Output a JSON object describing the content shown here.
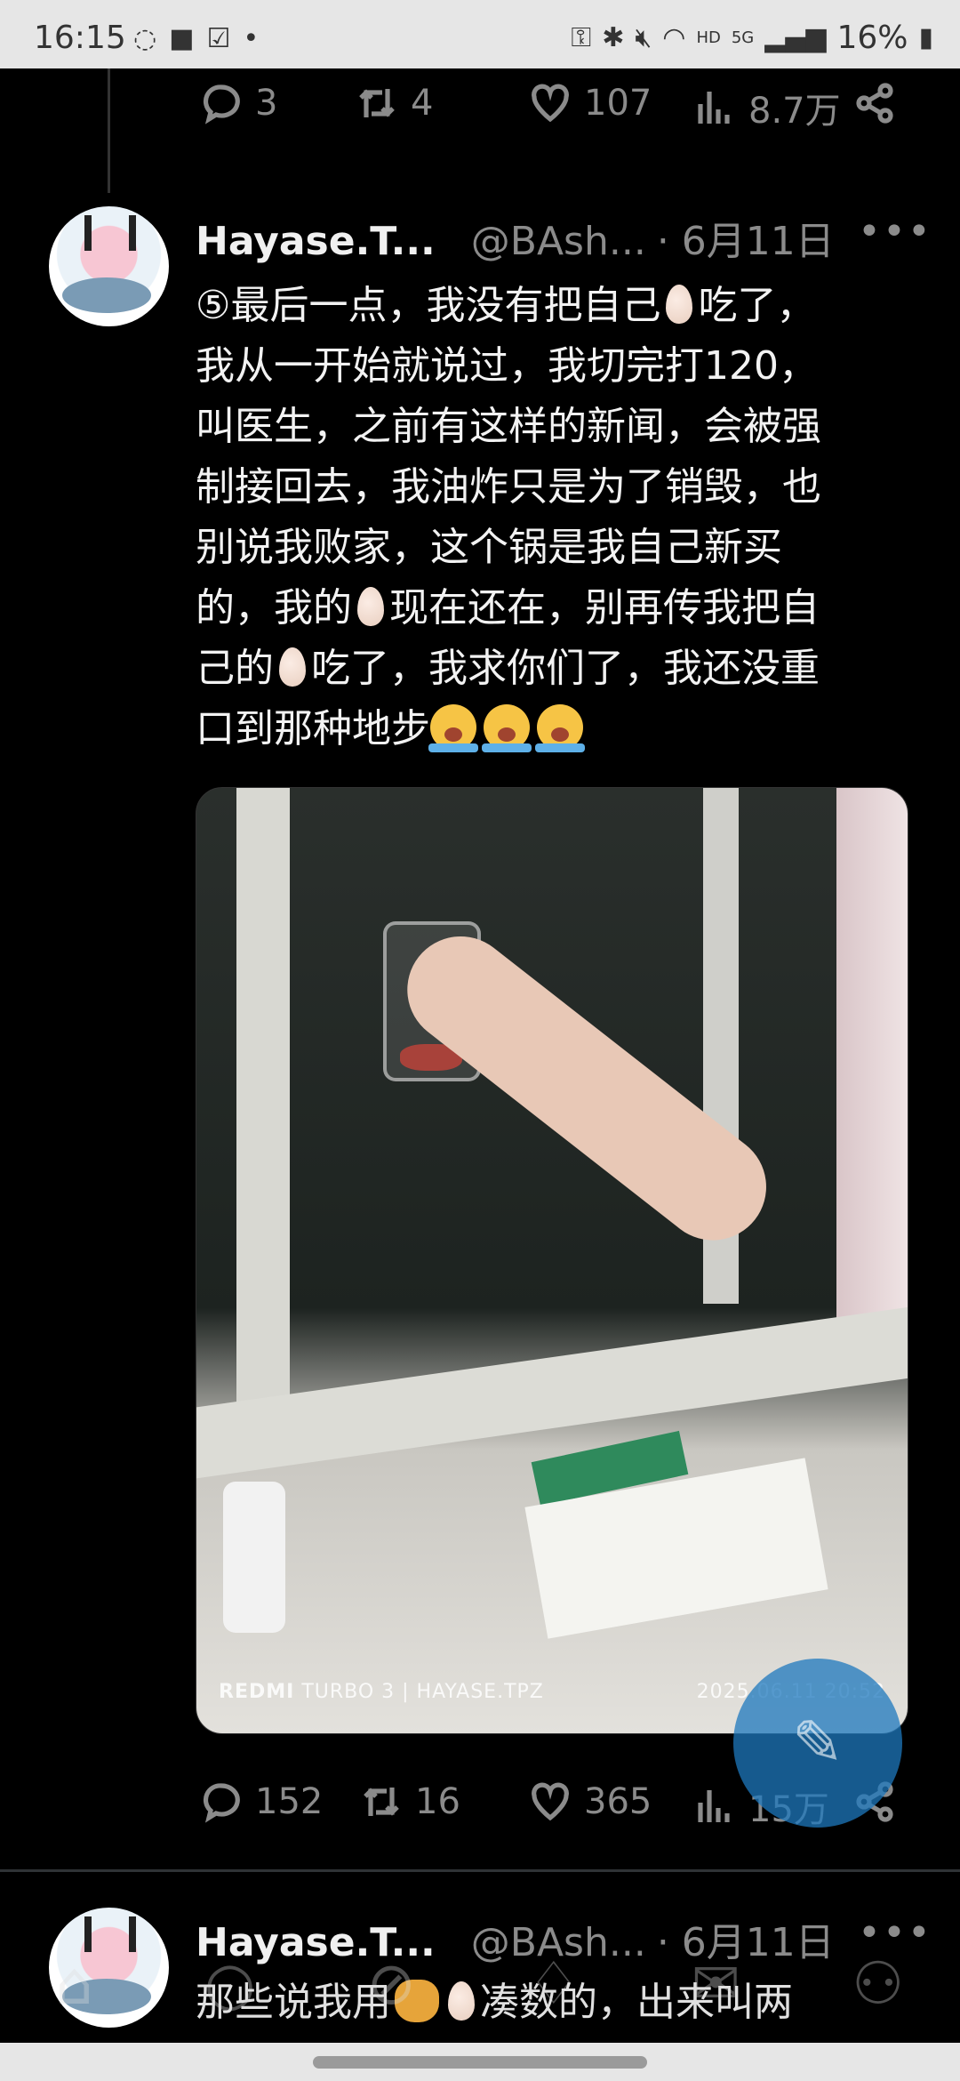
{
  "status_bar": {
    "time": "16:15",
    "network": "5G",
    "hd": "HD",
    "battery": "16%"
  },
  "prev_post": {
    "actions": {
      "replies": "3",
      "reposts": "4",
      "likes": "107",
      "views": "8.7万"
    }
  },
  "post": {
    "author_name": "Hayase.T...",
    "handle": "@BAsh...",
    "date": "· 6月11日",
    "more": "•••",
    "lines": [
      "⑤最后一点，我没有把自己",
      "吃了，",
      "我从一开始就说过，我切完打120，",
      "叫医生，之前有这样的新闻，会被强",
      "制接回去，我油炸只是为了销毁，也",
      "别说我败家，这个锅是我自己新买",
      "的，我的",
      "现在还在，别再传我把自",
      "己的",
      "吃了，我求你们了，我还没重",
      "口到那种地步"
    ],
    "photo": {
      "watermark_brand": "REDMI",
      "watermark_model": "TURBO 3 | HAYASE.TPZ",
      "watermark_date": "2025.06.11 20:52"
    },
    "actions": {
      "replies": "152",
      "reposts": "16",
      "likes": "365",
      "views": "15万"
    }
  },
  "next_post": {
    "author_name": "Hayase.T...",
    "handle": "@BAsh...",
    "date": "· 6月11日",
    "line_a": "那些说我用",
    "line_b": "凑数的，出来叫两"
  },
  "fab": {
    "icon": "compose-icon",
    "color": "#1d78be"
  },
  "bottom_nav": [
    "home-icon",
    "search-icon",
    "grok-icon",
    "notifications-icon",
    "messages-icon",
    "communities-icon"
  ]
}
